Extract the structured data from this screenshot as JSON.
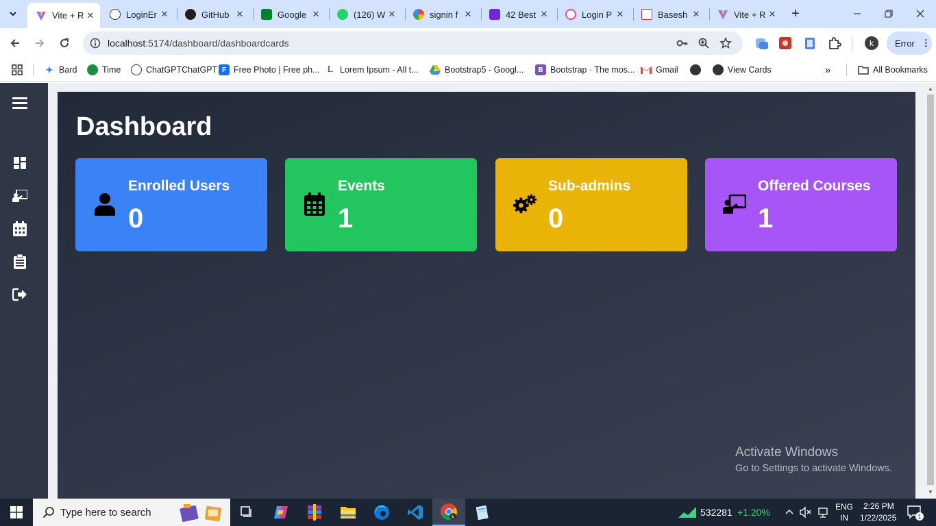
{
  "browser": {
    "tabs": [
      {
        "title": "Vite + R",
        "active": true,
        "favicon": "vite-icon"
      },
      {
        "title": "LoginEr",
        "active": false,
        "favicon": "openai-icon"
      },
      {
        "title": "GitHub",
        "active": false,
        "favicon": "github-icon"
      },
      {
        "title": "Google",
        "active": false,
        "favicon": "google-meet-icon"
      },
      {
        "title": "(126) W",
        "active": false,
        "favicon": "whatsapp-icon"
      },
      {
        "title": "signin f",
        "active": false,
        "favicon": "google-icon"
      },
      {
        "title": "42 Best",
        "active": false,
        "favicon": "colorlib-icon"
      },
      {
        "title": "Login P",
        "active": false,
        "favicon": "dribbble-icon"
      },
      {
        "title": "Basesh",
        "active": false,
        "favicon": "bookmark-red-icon"
      },
      {
        "title": "Vite + R",
        "active": false,
        "favicon": "vite-icon"
      }
    ],
    "url_host": "localhost",
    "url_path": ":5174/dashboard/dashboardcards",
    "error_label": "Error",
    "profile_initial": "k",
    "bookmarks": [
      {
        "label": "Bard",
        "icon": "bard-icon"
      },
      {
        "label": "Time",
        "icon": "time-icon"
      },
      {
        "label": "ChatGPTChatGPT",
        "icon": "openai-icon"
      },
      {
        "label": "Free Photo | Free ph...",
        "icon": "freepik-icon"
      },
      {
        "label": "Lorem Ipsum - All t...",
        "icon": "lorem-icon"
      },
      {
        "label": "Bootstrap5 - Googl...",
        "icon": "google-drive-icon"
      },
      {
        "label": "Bootstrap · The mos...",
        "icon": "bootstrap-icon"
      },
      {
        "label": "Gmail",
        "icon": "gmail-icon"
      },
      {
        "label": "",
        "icon": "globe-icon"
      },
      {
        "label": "View Cards",
        "icon": "globe-icon"
      }
    ],
    "all_bookmarks": "All Bookmarks"
  },
  "dashboard": {
    "title": "Dashboard",
    "cards": [
      {
        "label": "Enrolled Users",
        "value": "0",
        "color": "#3b82f6",
        "icon": "user-icon"
      },
      {
        "label": "Events",
        "value": "1",
        "color": "#22c55e",
        "icon": "calendar-icon"
      },
      {
        "label": "Sub-admins",
        "value": "0",
        "color": "#eab308",
        "icon": "gears-icon"
      },
      {
        "label": "Offered Courses",
        "value": "1",
        "color": "#a855f7",
        "icon": "chalkboard-teacher-icon"
      }
    ],
    "sidebar": [
      "menu-icon",
      "dashboard-icon",
      "chalkboard-teacher-icon",
      "calendar-icon",
      "clipboard-icon",
      "logout-icon"
    ]
  },
  "watermark": {
    "line1": "Activate Windows",
    "line2": "Go to Settings to activate Windows."
  },
  "taskbar": {
    "search_placeholder": "Type here to search",
    "stock_value": "532281",
    "stock_change": "+1.20%",
    "lang1": "ENG",
    "lang2": "IN",
    "time": "2:26 PM",
    "date": "1/22/2025",
    "notification_count": "1"
  },
  "colors": {
    "sidebar": "#2f3646",
    "main_bg": "#2b3242",
    "tabstrip": "#d3e3fd",
    "taskbar": "#1b2433",
    "stock_up": "#3fd17b"
  }
}
